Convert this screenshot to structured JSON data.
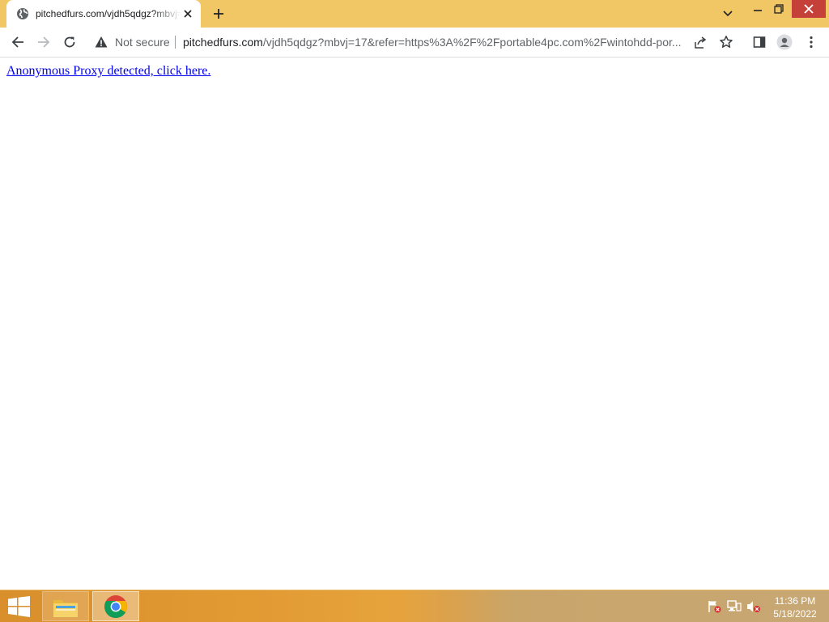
{
  "browser": {
    "tab": {
      "title": "pitchedfurs.com/vjdh5qdgz?mbvj=17",
      "favicon": "globe-icon"
    },
    "omnibox": {
      "security_label": "Not secure",
      "url_host": "pitchedfurs.com",
      "url_rest": "/vjdh5qdgz?mbvj=17&refer=https%3A%2F%2Fportable4pc.com%2Fwintohdd-por..."
    },
    "colors": {
      "frame": "#f1c665",
      "close_button": "#c6403a"
    }
  },
  "page": {
    "link_text": "Anonymous Proxy detected, click here.",
    "link_color": "#0000ee"
  },
  "taskbar": {
    "apps": [
      "file-explorer-icon",
      "chrome-icon"
    ],
    "tray_icons": [
      "action-center-flag-icon",
      "network-icon",
      "volume-muted-icon"
    ],
    "clock": {
      "time": "11:36 PM",
      "date": "5/18/2022"
    }
  }
}
